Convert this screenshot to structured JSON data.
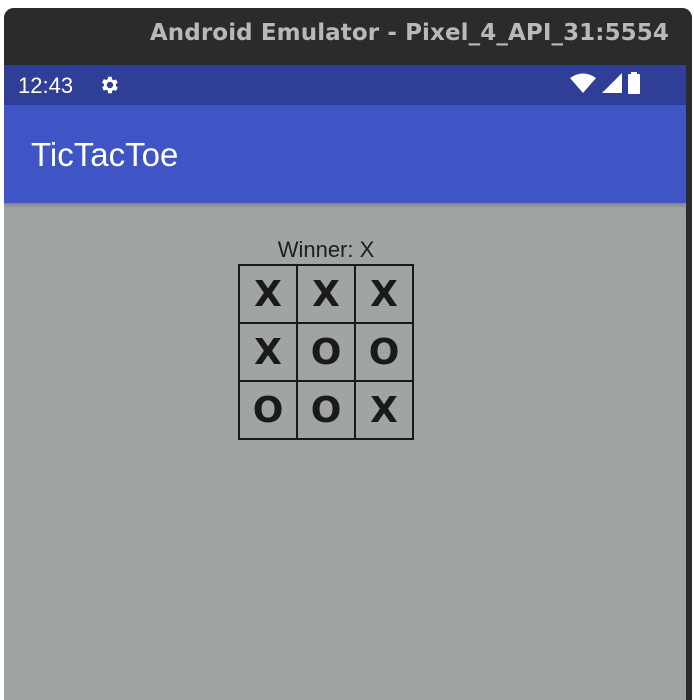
{
  "window": {
    "title": "Android Emulator - Pixel_4_API_31:5554"
  },
  "statusbar": {
    "time": "12:43",
    "icons": [
      "gear-icon",
      "wifi-icon",
      "signal-icon",
      "battery-icon"
    ],
    "color": "#2f3f97"
  },
  "appbar": {
    "title": "TicTacToe",
    "color": "#3f55c6"
  },
  "game": {
    "winner_text": "Winner: X",
    "board": [
      [
        "X",
        "X",
        "X"
      ],
      [
        "X",
        "O",
        "O"
      ],
      [
        "O",
        "O",
        "X"
      ]
    ],
    "background": "#a0a4a5"
  }
}
